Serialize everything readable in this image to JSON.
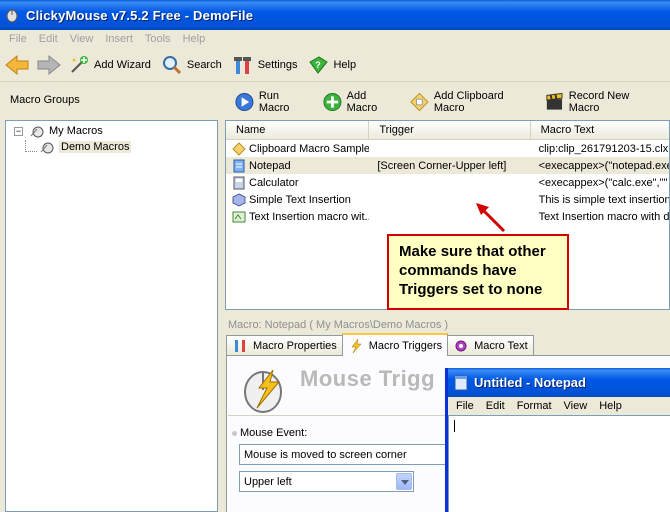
{
  "window": {
    "title": "ClickyMouse v7.5.2 Free - DemoFile"
  },
  "menu": [
    "File",
    "Edit",
    "View",
    "Insert",
    "Tools",
    "Help"
  ],
  "toolbar": {
    "add_wizard": "Add Wizard",
    "search": "Search",
    "settings": "Settings",
    "help": "Help"
  },
  "left_panel": {
    "header": "Macro Groups",
    "tree": {
      "root": "My Macros",
      "child": "Demo Macros"
    }
  },
  "right_toolbar": {
    "run_macro": "Run Macro",
    "add_macro": "Add Macro",
    "add_clipboard_macro": "Add Clipboard Macro",
    "record_new_macro": "Record New Macro"
  },
  "list": {
    "columns": [
      "Name",
      "Trigger",
      "Macro Text"
    ],
    "rows": [
      {
        "name": "Clipboard Macro Sample",
        "trigger": "",
        "text": "clip:clip_261791203-15.clx",
        "icon": "clipboard-icon"
      },
      {
        "name": "Notepad",
        "trigger": "[Screen Corner-Upper left]",
        "text": "<execappex>(\"notepad.exe",
        "icon": "notepad-icon"
      },
      {
        "name": "Calculator",
        "trigger": "",
        "text": "<execappex>(\"calc.exe\",\"\"",
        "icon": "calculator-icon"
      },
      {
        "name": "Simple Text Insertion",
        "trigger": "",
        "text": "This is simple text insertion n",
        "icon": "cube-icon"
      },
      {
        "name": "Text Insertion macro wit...",
        "trigger": "",
        "text": "Text Insertion macro with da",
        "icon": "text-macro-icon"
      }
    ]
  },
  "callout": {
    "text": "Make sure that other commands have Triggers set to none"
  },
  "macro_info": "Macro: Notepad ( My Macros\\Demo Macros )",
  "tabs": [
    "Macro Properties",
    "Macro Triggers",
    "Macro Text"
  ],
  "triggers_panel": {
    "title": "Mouse Trigg",
    "mouse_event_label": "Mouse Event:",
    "mouse_event_value": "Mouse is moved to screen corner",
    "corner_value": "Upper left"
  },
  "notepad": {
    "title": "Untitled - Notepad",
    "menu": [
      "File",
      "Edit",
      "Format",
      "View",
      "Help"
    ]
  }
}
